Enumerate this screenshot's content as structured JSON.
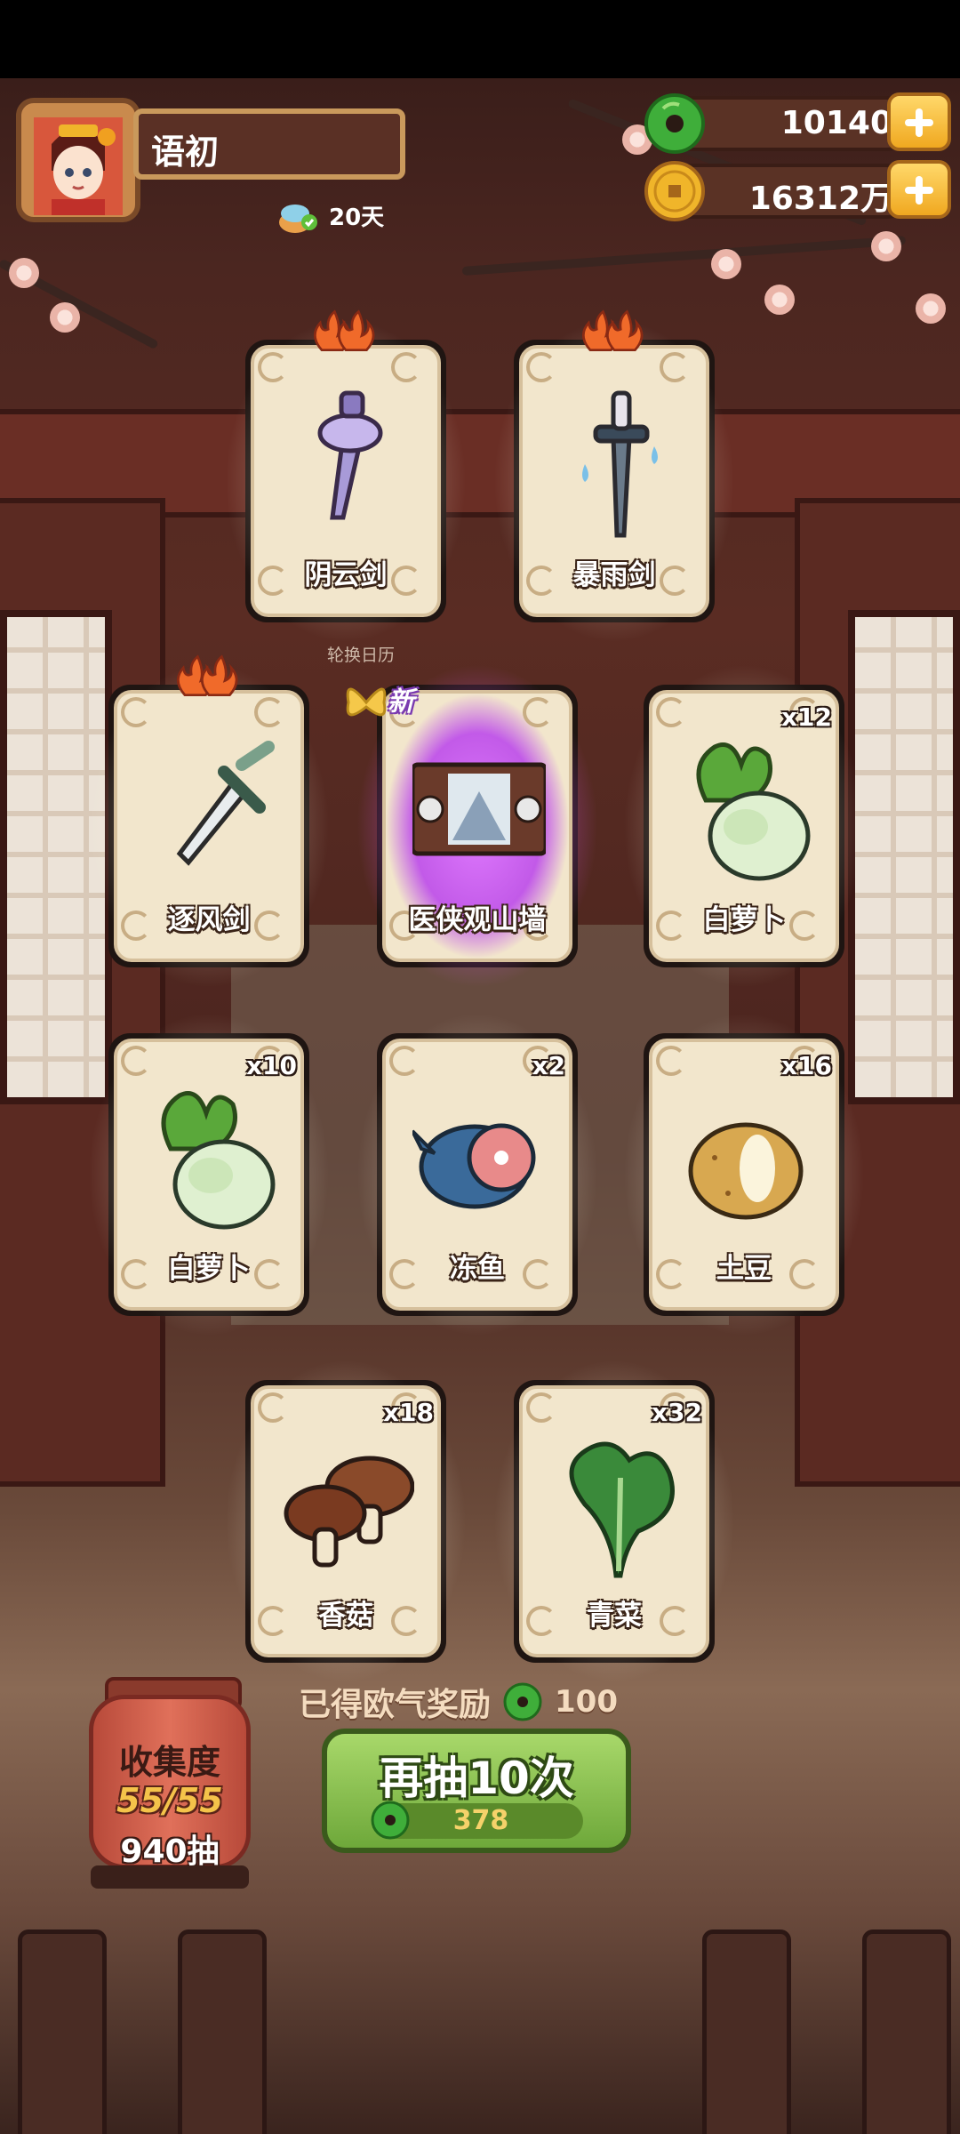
{
  "player": {
    "name": "语初",
    "days": "20天"
  },
  "currency": {
    "jade": "10140",
    "coins": "16312万"
  },
  "board_text": "轮换日历",
  "cards": [
    {
      "label": "阴云剑",
      "count": "",
      "hot": true,
      "new": false,
      "item": "purple-sword"
    },
    {
      "label": "暴雨剑",
      "count": "",
      "hot": true,
      "new": false,
      "item": "rain-sword"
    },
    {
      "label": "逐风剑",
      "count": "",
      "hot": true,
      "new": false,
      "item": "wind-sword"
    },
    {
      "label": "医侠观山墙",
      "count": "",
      "hot": false,
      "new": true,
      "new_label": "新",
      "item": "mountain-wall"
    },
    {
      "label": "白萝卜",
      "count": "x12",
      "hot": false,
      "new": false,
      "item": "radish"
    },
    {
      "label": "白萝卜",
      "count": "x10",
      "hot": false,
      "new": false,
      "item": "radish"
    },
    {
      "label": "冻鱼",
      "count": "x2",
      "hot": false,
      "new": false,
      "item": "frozen-fish"
    },
    {
      "label": "土豆",
      "count": "x16",
      "hot": false,
      "new": false,
      "item": "potato"
    },
    {
      "label": "香菇",
      "count": "x18",
      "hot": false,
      "new": false,
      "item": "mushroom"
    },
    {
      "label": "青菜",
      "count": "x32",
      "hot": false,
      "new": false,
      "item": "greens"
    }
  ],
  "reward": {
    "label": "已得欧气奖励",
    "value": "100"
  },
  "collection": {
    "title": "收集度",
    "progress": "55/55",
    "draws": "940抽"
  },
  "draw_button": {
    "label": "再抽10次",
    "cost": "378"
  },
  "colors": {
    "jade": "#3fae3a",
    "gold": "#f0b52a",
    "button_green": "#8cc652",
    "purple_glow": "#d45cff"
  }
}
